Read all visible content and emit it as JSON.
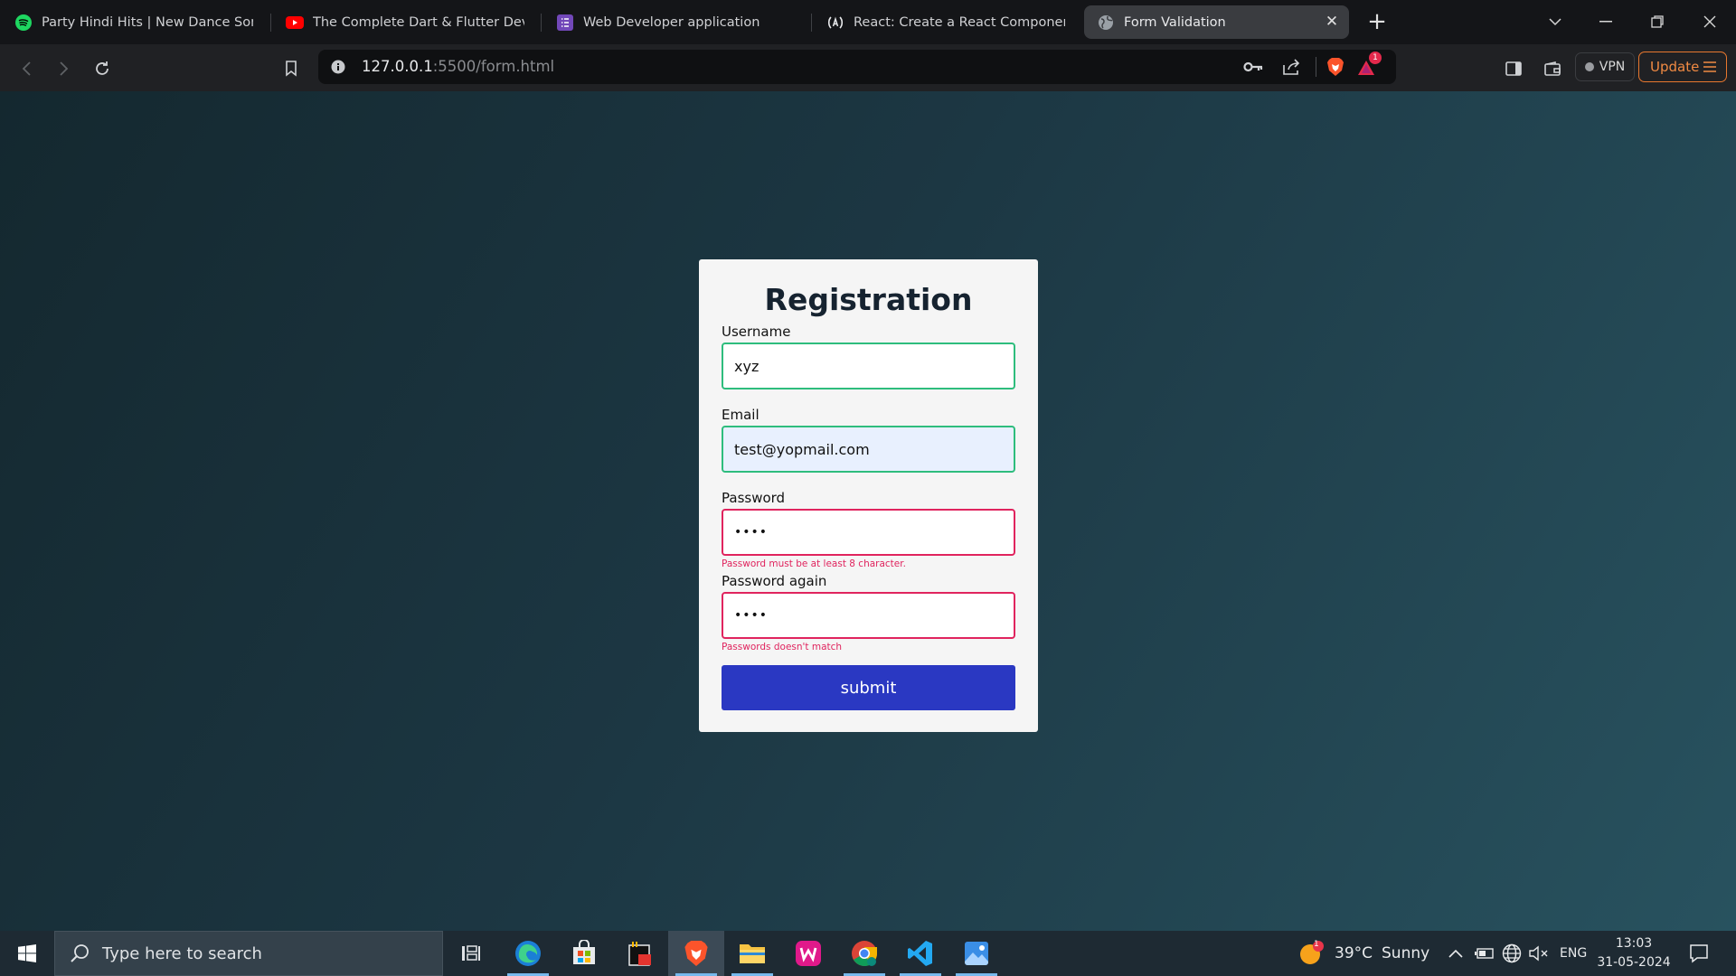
{
  "browser": {
    "tabs": [
      {
        "title": "Party Hindi Hits | New Dance Songs",
        "icon": "spotify-icon"
      },
      {
        "title": "The Complete Dart & Flutter Develop",
        "icon": "youtube-icon"
      },
      {
        "title": "Web Developer application",
        "icon": "form-icon"
      },
      {
        "title": "React: Create a React Component | fr",
        "icon": "freecodecamp-icon"
      },
      {
        "title": "Form Validation",
        "icon": "globe-icon",
        "active": true
      }
    ],
    "close_glyph": "✕",
    "new_tab_glyph": "+",
    "url": {
      "host": "127.0.0.1",
      "rest": ":5500/form.html"
    },
    "notification_count": "1",
    "vpn_label": "VPN",
    "update_label": "Update"
  },
  "form": {
    "title": "Registration",
    "fields": [
      {
        "label": "Username",
        "value": "xyz",
        "state": "valid",
        "error": ""
      },
      {
        "label": "Email",
        "value": "test@yopmail.com",
        "state": "valid-autofill",
        "error": ""
      },
      {
        "label": "Password",
        "value": "••••",
        "state": "error",
        "error": "Password must be at least 8 character."
      },
      {
        "label": "Password again",
        "value": "••••",
        "state": "error",
        "error": "Passwords doesn't match"
      }
    ],
    "submit_label": "submit"
  },
  "taskbar": {
    "search_placeholder": "Type here to search",
    "weather": {
      "temp": "39°C",
      "condition": "Sunny",
      "badge": "1"
    },
    "language": "ENG",
    "time": "13:03",
    "date": "31-05-2024"
  },
  "colors": {
    "valid_border": "#2ebd7d",
    "error": "#e0245e",
    "submit_bg": "#2a38c2",
    "update_accent": "#e8772e"
  }
}
